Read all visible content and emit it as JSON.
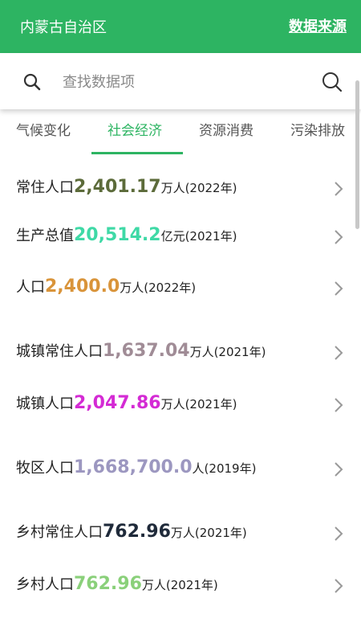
{
  "header": {
    "title": "内蒙古自治区",
    "source_link": "数据来源"
  },
  "search": {
    "placeholder": "查找数据项"
  },
  "tabs": [
    {
      "label": "气候变化"
    },
    {
      "label": "社会经济"
    },
    {
      "label": "资源消费"
    },
    {
      "label": "污染排放"
    }
  ],
  "active_tab": "社会经济",
  "accent_color": "#2db462",
  "items": [
    {
      "label": "常住人口",
      "value": "2,401.17",
      "unit": "万人(2022年)",
      "color": "#5c6b3a"
    },
    {
      "label": "生产总值",
      "value": "20,514.2",
      "unit": "亿元(2021年)",
      "color": "#3fd9a6"
    },
    {
      "label": "人口",
      "value": "2,400.0",
      "unit": "万人(2022年)",
      "color": "#d9943a"
    },
    {
      "label": "城镇常住人口",
      "value": "1,637.04",
      "unit": "万人(2021年)",
      "color": "#a08c96"
    },
    {
      "label": "城镇人口",
      "value": "2,047.86",
      "unit": "万人(2021年)",
      "color": "#d42bd4"
    },
    {
      "label": "牧区人口",
      "value": "1,668,700.0",
      "unit": "人(2019年)",
      "color": "#9c97c0"
    },
    {
      "label": "乡村常住人口",
      "value": "762.96",
      "unit": "万人(2021年)",
      "color": "#1f2a3a"
    },
    {
      "label": "乡村人口",
      "value": "762.96",
      "unit": "万人(2021年)",
      "color": "#8ad07a"
    }
  ]
}
